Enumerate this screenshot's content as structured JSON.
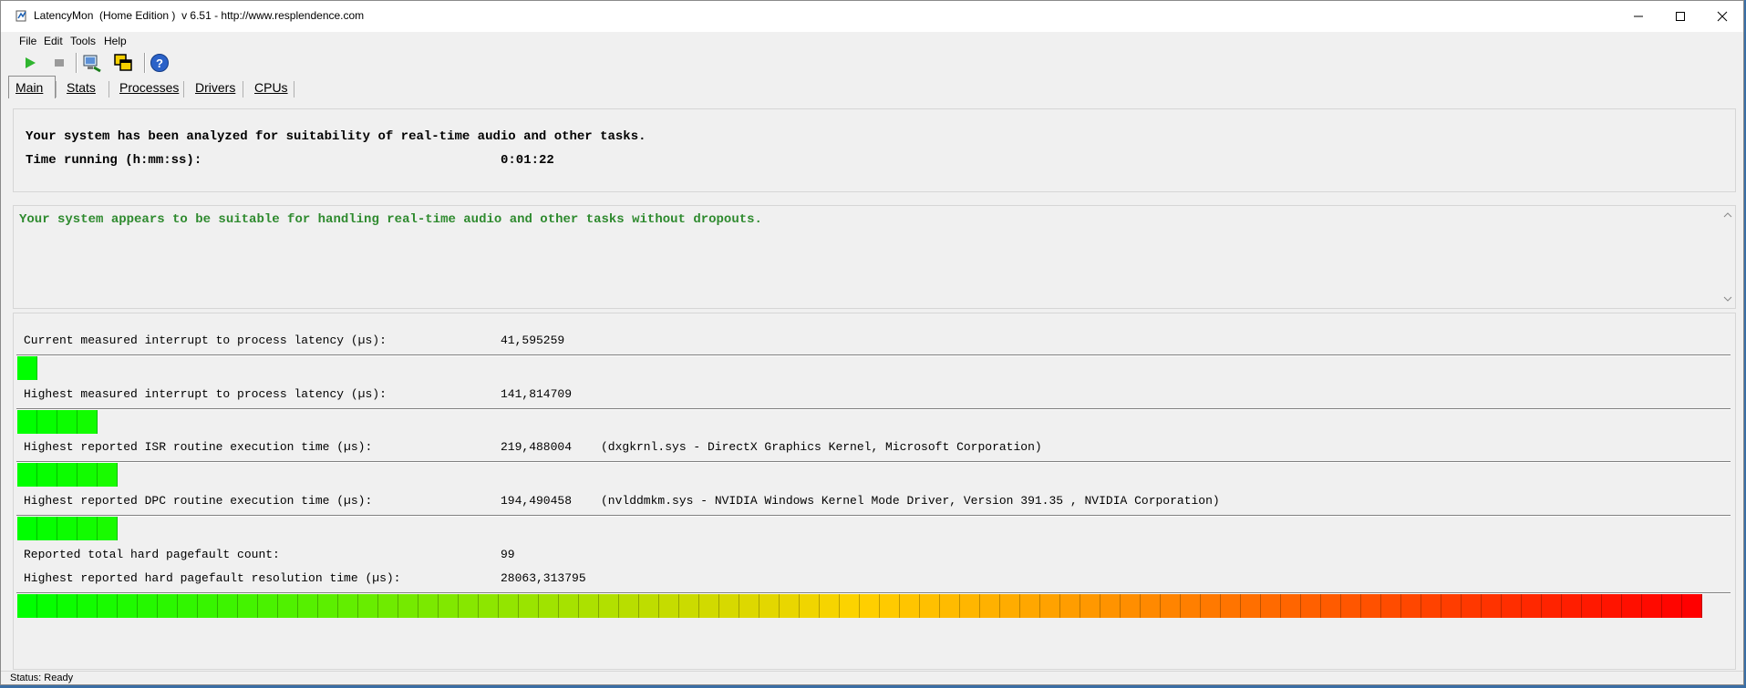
{
  "window": {
    "title": "LatencyMon  (Home Edition )  v 6.51 - http://www.resplendence.com",
    "minimize_icon": "minimize-icon",
    "maximize_icon": "maximize-icon",
    "close_icon": "close-icon"
  },
  "menu": [
    "File",
    "Edit",
    "Tools",
    "Help"
  ],
  "toolbar": {
    "icons": [
      "play-icon",
      "stop-icon",
      "computer-report-icon",
      "windows-copy-icon",
      "help-icon"
    ]
  },
  "tabs": [
    "Main",
    "Stats",
    "Processes",
    "Drivers",
    "CPUs"
  ],
  "summary": {
    "line1": "Your system has been analyzed for suitability of real-time audio and other tasks.",
    "time_label": "Time running (h:mm:ss):",
    "time_value": "0:01:22"
  },
  "verdict": {
    "text": "Your system appears to be suitable for handling real-time audio and other tasks without dropouts.",
    "color": "#2e8a2e"
  },
  "metrics": [
    {
      "label": "Current measured interrupt to process latency (µs):",
      "value": "41,595259",
      "note": "",
      "meter_level": 0.01
    },
    {
      "label": "Highest measured interrupt to process latency (µs):",
      "value": "141,814709",
      "note": "",
      "meter_level": 0.045
    },
    {
      "label": "Highest reported ISR routine execution time (µs):",
      "value": "219,488004",
      "note": "(dxgkrnl.sys - DirectX Graphics Kernel, Microsoft Corporation)",
      "meter_level": 0.06
    },
    {
      "label": "Highest reported DPC routine execution time (µs):",
      "value": "194,490458",
      "note": "(nvlddmkm.sys - NVIDIA Windows Kernel Mode Driver, Version 391.35 , NVIDIA Corporation)",
      "meter_level": 0.06
    },
    {
      "label": "Reported total hard pagefault count:",
      "value": "99",
      "note": ""
    },
    {
      "label": "Highest reported hard pagefault resolution time (µs):",
      "value": "28063,313795",
      "note": "",
      "meter_level": 1.0
    }
  ],
  "status": "Status: Ready",
  "colors": {
    "meter_low": "#00ff00",
    "meter_high": "#ff0000",
    "verdict_green": "#2e8a2e"
  }
}
